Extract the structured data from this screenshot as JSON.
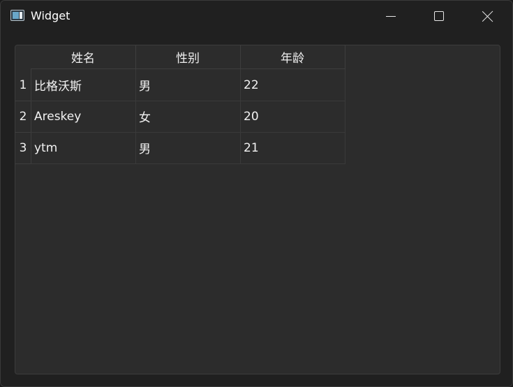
{
  "window": {
    "title": "Widget",
    "icon": "app-window-icon",
    "controls": [
      "minimize-icon",
      "maximize-icon",
      "close-icon"
    ]
  },
  "table": {
    "columns": [
      "姓名",
      "性别",
      "年龄"
    ],
    "row_headers": [
      "1",
      "2",
      "3"
    ],
    "rows": [
      [
        "比格沃斯",
        "男",
        "22"
      ],
      [
        "Areskey",
        "女",
        "20"
      ],
      [
        "ytm",
        "男",
        "21"
      ]
    ]
  },
  "colors": {
    "window_bg": "#202020",
    "table_bg": "#2c2c2c",
    "text": "#f2f2f2",
    "gridline": "#3a3a3a"
  }
}
